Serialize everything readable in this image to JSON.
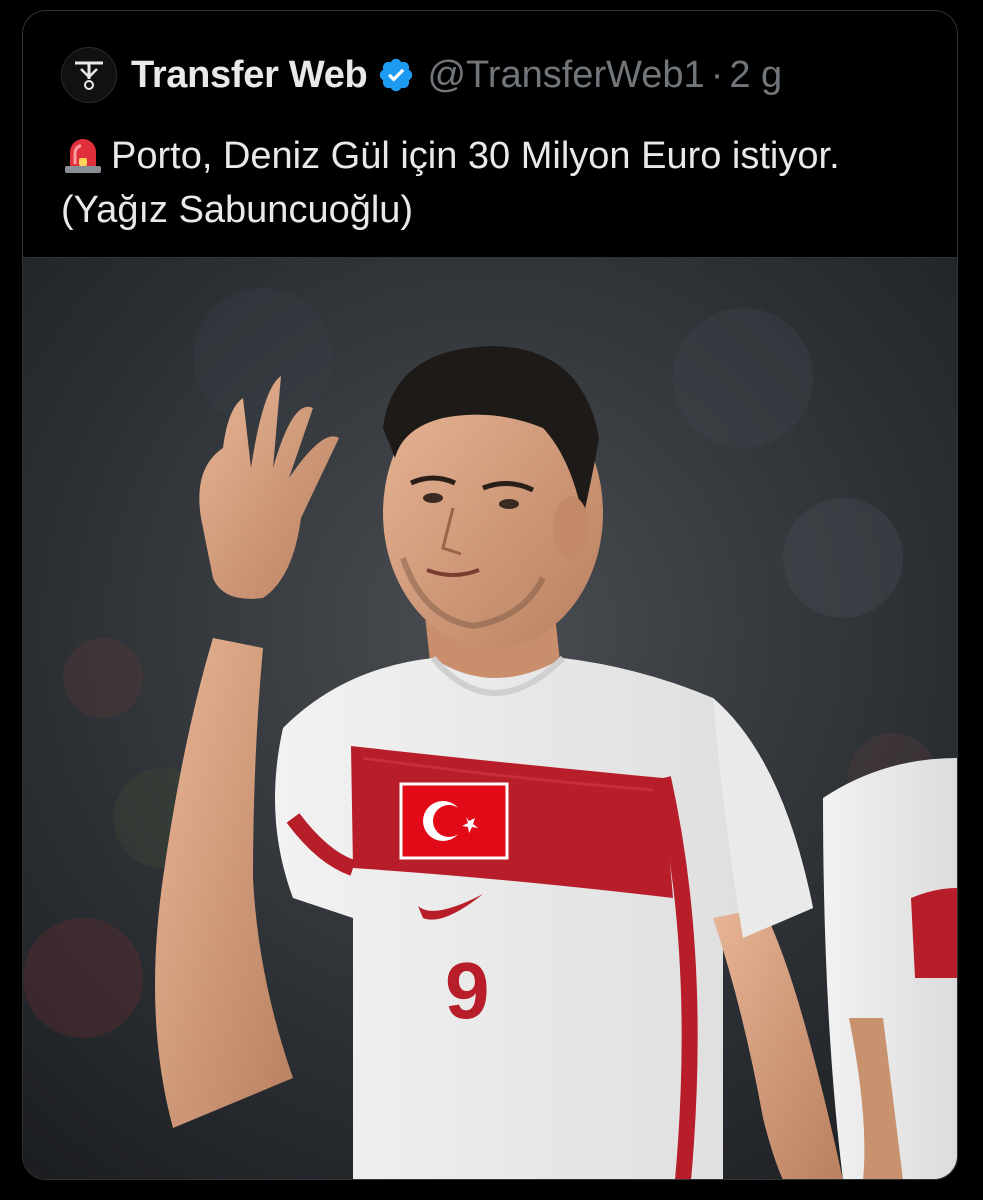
{
  "tweet": {
    "display_name": "Transfer Web",
    "handle": "@TransferWeb1",
    "separator": "·",
    "time": "2 g",
    "text": "Porto, Deniz Gül için 30 Milyon Euro istiyor. (Yağız Sabuncuoğlu)",
    "avatar_icon": "transfer-web-logo",
    "verified_icon": "verified-badge-icon",
    "siren_icon": "rotating-light-emoji"
  },
  "media": {
    "alt": "Player in white Turkey jersey number 9 raising hand",
    "jersey_number": "9"
  },
  "colors": {
    "background": "#000000",
    "text": "#e7e9ea",
    "muted": "#71767b",
    "verified": "#1d9bf0",
    "border": "#2f3336",
    "jersey_red": "#b81d2a"
  }
}
